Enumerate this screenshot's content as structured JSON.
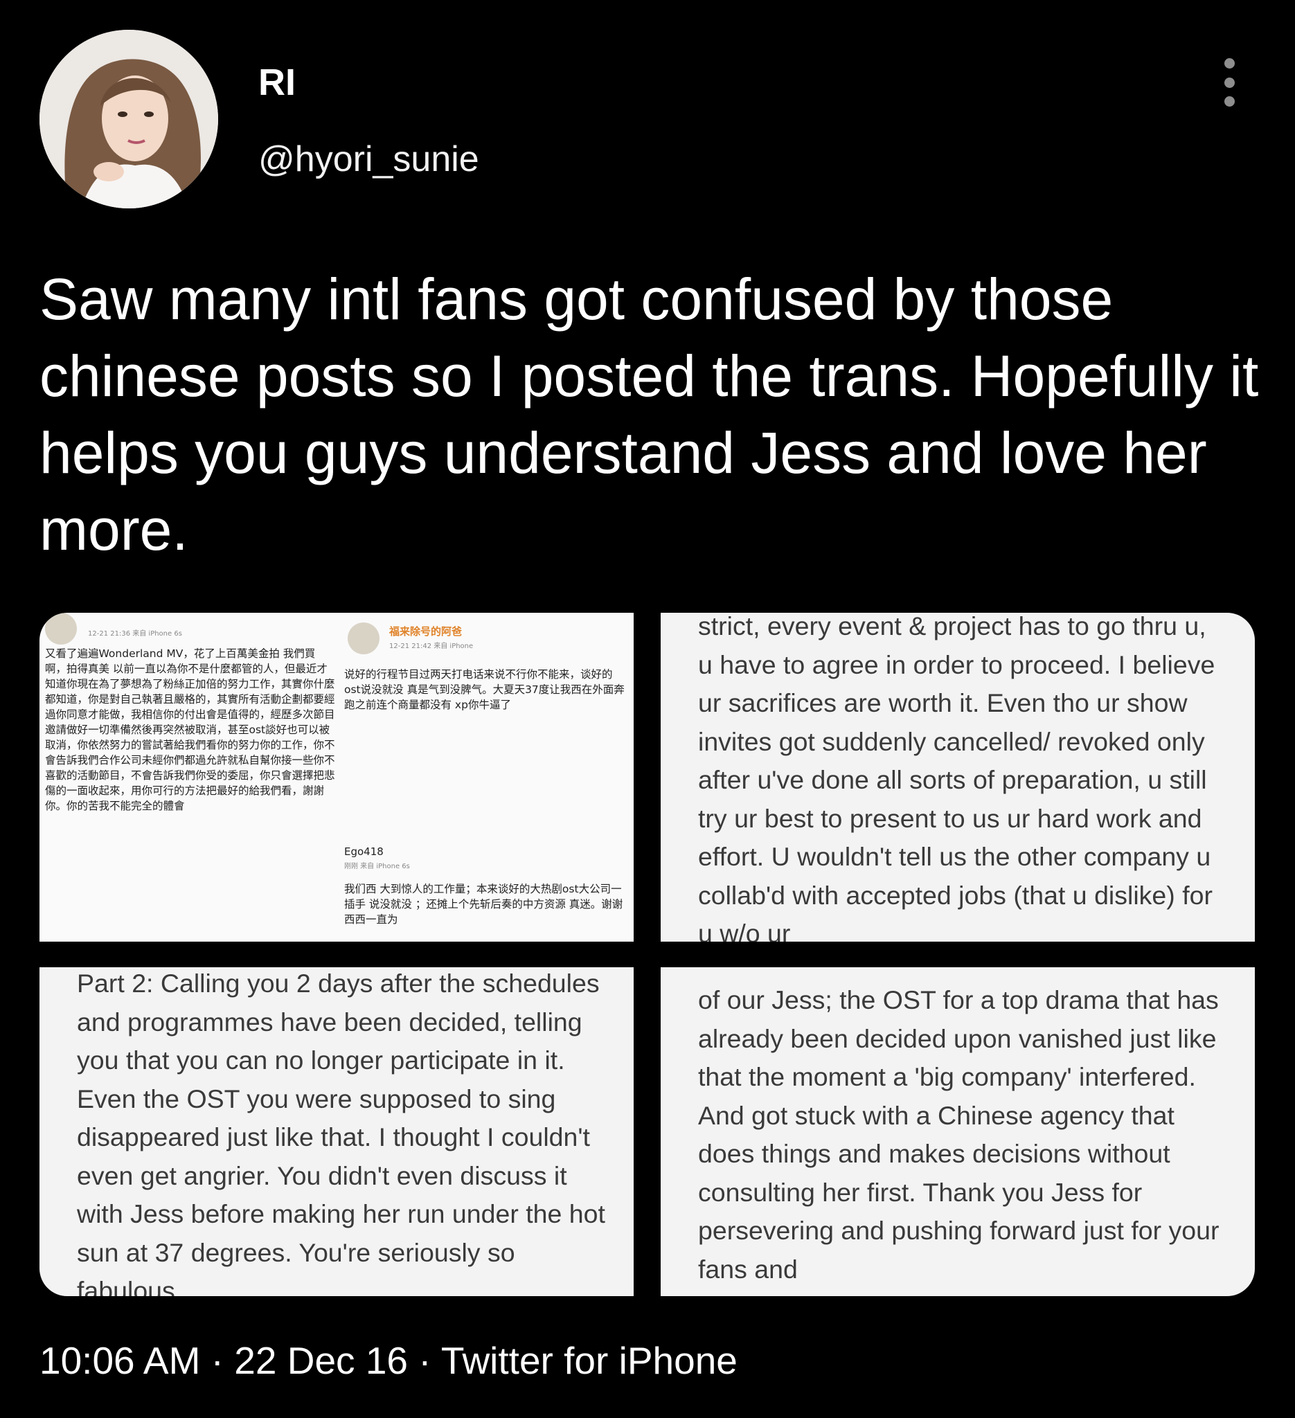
{
  "author": {
    "display_name": "RI",
    "handle": "@hyori_sunie"
  },
  "tweet": {
    "text": "Saw many intl fans got confused by those chinese posts so I posted the trans. Hopefully it helps you guys understand Jess and love her more."
  },
  "media": {
    "post_a": {
      "meta": "12-21 21:36 来自 iPhone 6s",
      "text": "又看了遍遍Wonderland MV，花了上百萬美金拍 我們買啊，拍得真美 以前一直以為你不是什麼都管的人，但最近才知道你現在為了夢想為了粉絲正加倍的努力工作，其實你什麼都知道，你是對自己執著且嚴格的，其實所有活動企劃都要經過你同意才能做，我相信你的付出會是值得的，經歷多次節目邀請做好一切準備然後再突然被取消，甚至ost談好也可以被取消，你依然努力的嘗試著給我們看你的努力你的工作，你不會告訴我們合作公司未經你們都過允許就私自幫你接一些你不喜歡的活動節目，不會告訴我們你受的委屈，你只會選擇把悲傷的一面收起來，用你可行的方法把最好的給我們看，謝謝你。你的苦我不能完全的體會"
    },
    "post_b": {
      "name": "福来除号的阿爸",
      "meta": "12-21 21:42 来自 iPhone",
      "text": "说好的行程节目过两天打电话来说不行你不能来，谈好的ost说没就没 真是气到没脾气。大夏天37度让我西在外面奔跑之前连个商量都没有 xp你牛逼了"
    },
    "post_c": {
      "name": "Ego418",
      "meta": "刚刚 来自 iPhone 6s",
      "text": "我们西 大到惊人的工作量；本来谈好的大热剧ost大公司一插手 说没就没 ；还摊上个先斩后奏的中方资源 真迷。谢谢西西一直为"
    },
    "trans_1": "strict, every event & project has to go thru u, u have to agree in order to proceed. I believe ur sacrifices are worth it. Even tho ur show invites got suddenly cancelled/ revoked only after u've done all sorts of preparation, u still try ur best to present to us ur hard work and effort. U wouldn't tell us the other company u collab'd with accepted jobs (that u dislike) for u w/o ur",
    "trans_2": "Part 2: Calling you 2 days after the schedules and programmes have been decided, telling you that you can no longer participate in it. Even the OST you were supposed to sing disappeared just like that. I thought I couldn't even get angrier. You didn't even discuss it with Jess before making her run under the hot sun at 37 degrees. You're seriously so fabulous.",
    "trans_3": "of our Jess; the OST for a top drama that has already been decided upon vanished just like that the moment a 'big company' interfered. And got stuck with a Chinese agency that does things and makes decisions without consulting her first. Thank you Jess for persevering and pushing forward just for your fans and"
  },
  "footer": {
    "time": "10:06 AM",
    "date": "22 Dec 16",
    "source": "Twitter for iPhone",
    "separator": " · "
  },
  "colors": {
    "background": "#000000",
    "text": "#ffffff",
    "overflow_dots": "#8e8e8e"
  },
  "icons": [
    "overflow-menu-icon"
  ]
}
